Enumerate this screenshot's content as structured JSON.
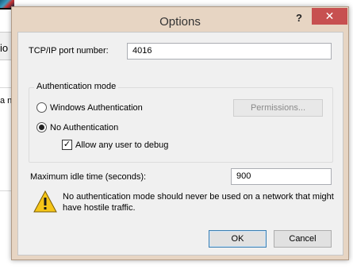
{
  "background": {
    "fragment_text_1": "io",
    "fragment_text_2": "a n"
  },
  "dialog": {
    "title": "Options",
    "help_glyph": "?",
    "close_glyph": "✕",
    "port": {
      "label": "TCP/IP port number:",
      "value": "4016"
    },
    "auth": {
      "group_label": "Authentication mode",
      "windows_label": "Windows Authentication",
      "windows_selected": false,
      "permissions_label": "Permissions...",
      "none_label": "No Authentication",
      "none_selected": true,
      "allow_any_label": "Allow any user to debug",
      "allow_any_checked": true
    },
    "idle": {
      "label": "Maximum idle time (seconds):",
      "value": "900"
    },
    "warning": {
      "icon": "warning-triangle-icon",
      "text": "No authentication mode should never be used on a network that might have hostile traffic."
    },
    "ok_label": "OK",
    "cancel_label": "Cancel"
  },
  "colors": {
    "frame": "#e7d5c3",
    "close_button": "#c75050",
    "client": "#f0f0f0",
    "default_button_border": "#3c7fb1"
  }
}
